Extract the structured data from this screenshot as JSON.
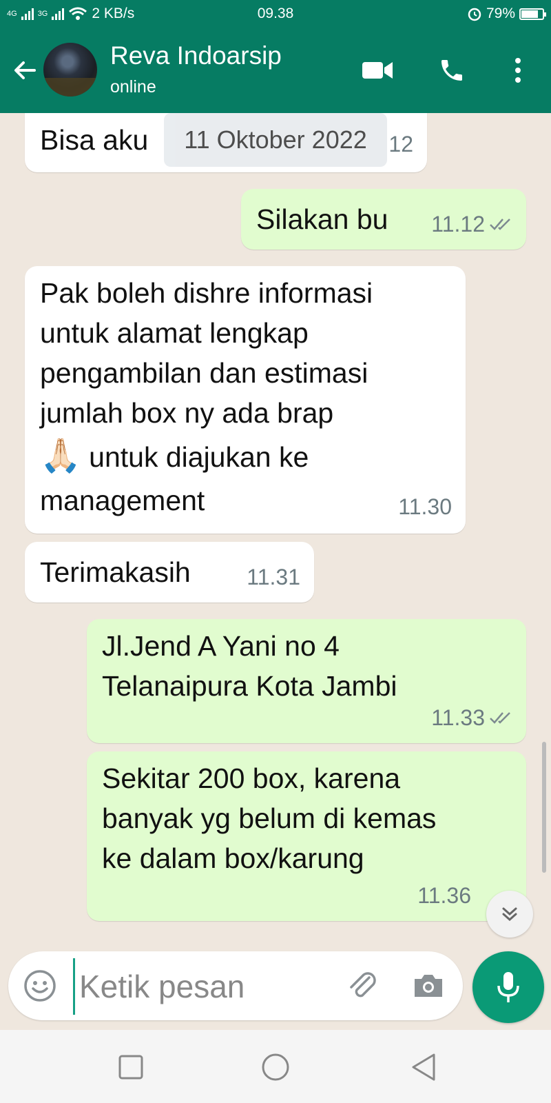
{
  "status_bar": {
    "network_1": "4G",
    "network_2": "3G",
    "data_speed": "2 KB/s",
    "time": "09.38",
    "battery_level": 0.79,
    "battery_text": "79%"
  },
  "header": {
    "contact_name": "Reva Indoarsip",
    "contact_status": "online",
    "icons": [
      "back-arrow-icon",
      "video-call-icon",
      "phone-icon",
      "more-options-icon"
    ]
  },
  "chat": {
    "date_chip": "11 Oktober 2022",
    "messages": [
      {
        "direction": "in",
        "text": "Bisa aku",
        "time": "12"
      },
      {
        "direction": "out",
        "text": "Silakan bu",
        "time": "11.12",
        "ticks": "double-check"
      },
      {
        "direction": "in",
        "lines": [
          "Pak boleh dishre informasi",
          "untuk alamat lengkap",
          "pengambilan dan estimasi",
          "jumlah box ny ada brap"
        ],
        "emoji": "🙏🏻",
        "lines_after": [
          "untuk diajukan ke",
          "management"
        ],
        "time": "11.30"
      },
      {
        "direction": "in",
        "text": "Terimakasih",
        "time": "11.31"
      },
      {
        "direction": "out",
        "lines": [
          "Jl.Jend A Yani no 4",
          "Telanaipura Kota Jambi"
        ],
        "time": "11.33",
        "ticks": "double-check"
      },
      {
        "direction": "out",
        "lines": [
          "Sekitar 200 box, karena",
          "banyak yg belum di kemas",
          "ke dalam box/karung"
        ],
        "time": "11.36"
      }
    ]
  },
  "composer": {
    "placeholder": "Ketik pesan",
    "accent_color": "#0a9a76"
  },
  "theme": {
    "header_color": "#067c63",
    "outgoing_bubble": "#e1fccf",
    "incoming_bubble": "#ffffff"
  }
}
